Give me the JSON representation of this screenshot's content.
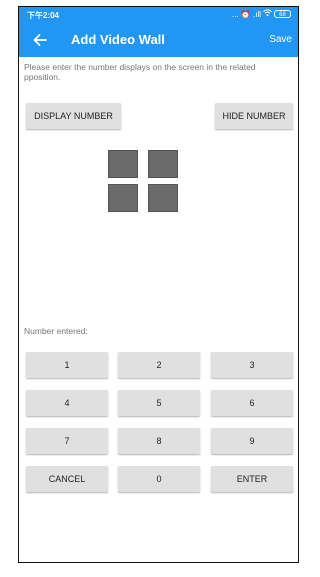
{
  "status_bar": {
    "time": "下午2:04",
    "icons": [
      "more-dots-icon",
      "alarm-icon",
      "signal-icon",
      "wifi-icon",
      "battery-icon"
    ],
    "indicators": "... ⏰ .ıll",
    "battery": "68"
  },
  "app_bar": {
    "title": "Add Video Wall",
    "save_label": "Save",
    "back_icon": "arrow-left-icon",
    "color": "#2196f3"
  },
  "instruction": "Please enter the number displays on the screen in the related pposition.",
  "buttons": {
    "display_number": "DISPLAY NUMBER",
    "hide_number": "HIDE NUMBER"
  },
  "video_wall": {
    "rows": 2,
    "columns": 2,
    "screen_color": "#6b6b6b"
  },
  "number_entered_label": "Number entered:",
  "keypad": [
    "1",
    "2",
    "3",
    "4",
    "5",
    "6",
    "7",
    "8",
    "9",
    "CANCEL",
    "0",
    "ENTER"
  ]
}
